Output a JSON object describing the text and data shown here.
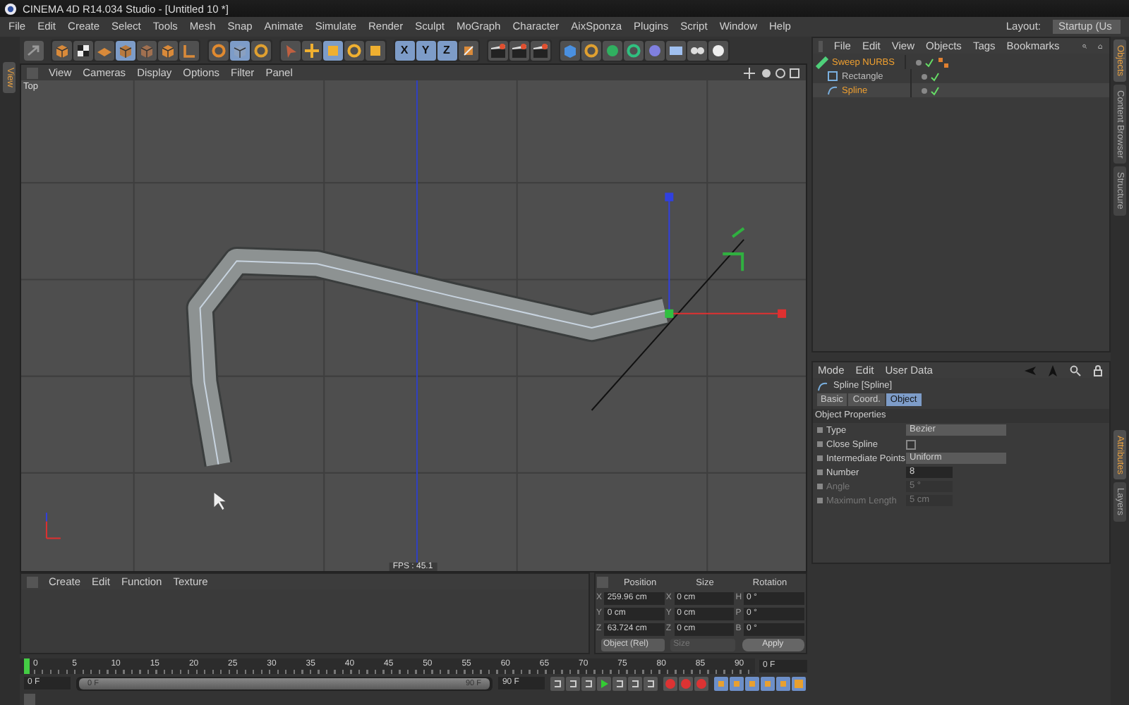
{
  "window": {
    "title": "CINEMA 4D R14.034 Studio - [Untitled 10 *]"
  },
  "menu": [
    "File",
    "Edit",
    "Create",
    "Select",
    "Tools",
    "Mesh",
    "Snap",
    "Animate",
    "Simulate",
    "Render",
    "Sculpt",
    "MoGraph",
    "Character",
    "AixSponza",
    "Plugins",
    "Script",
    "Window",
    "Help"
  ],
  "layout": {
    "label": "Layout:",
    "value": "Startup (Us"
  },
  "axis_buttons": [
    {
      "label": "X",
      "selected": true
    },
    {
      "label": "Y",
      "selected": true
    },
    {
      "label": "Z",
      "selected": true
    }
  ],
  "left_tabs": [
    {
      "label": "View",
      "selected": true
    }
  ],
  "viewport": {
    "menu": [
      "View",
      "Cameras",
      "Display",
      "Options",
      "Filter",
      "Panel"
    ],
    "view_name": "Top",
    "fps": "FPS : 45.1"
  },
  "object_manager": {
    "menu": [
      "File",
      "Edit",
      "View",
      "Objects",
      "Tags",
      "Bookmarks"
    ],
    "objects": [
      {
        "name": "Sweep NURBS",
        "selected": true,
        "children": [
          {
            "name": "Rectangle",
            "selected": false
          },
          {
            "name": "Spline",
            "selected": true
          }
        ]
      }
    ]
  },
  "right_tabs_top": [
    {
      "label": "Objects",
      "selected": true
    },
    {
      "label": "Content Browser",
      "selected": false
    },
    {
      "label": "Structure",
      "selected": false
    }
  ],
  "right_tabs_bottom": [
    {
      "label": "Attributes",
      "selected": true
    },
    {
      "label": "Layers",
      "selected": false
    }
  ],
  "attributes": {
    "menu": [
      "Mode",
      "Edit",
      "User Data"
    ],
    "object": "Spline [Spline]",
    "tabs": [
      {
        "label": "Basic",
        "selected": false
      },
      {
        "label": "Coord.",
        "selected": false
      },
      {
        "label": "Object",
        "selected": true
      }
    ],
    "section": "Object Properties",
    "params": [
      {
        "label": "Type",
        "kind": "dropdown",
        "value": "Bezier",
        "disabled": false
      },
      {
        "label": "Close Spline",
        "kind": "checkbox",
        "checked": false,
        "disabled": false
      },
      {
        "label": "Intermediate Points",
        "kind": "dropdown",
        "value": "Uniform",
        "disabled": false
      },
      {
        "label": "Number",
        "kind": "number",
        "value": "8",
        "disabled": false
      },
      {
        "label": "Angle",
        "kind": "number",
        "value": "5 °",
        "disabled": true
      },
      {
        "label": "Maximum Length",
        "kind": "number",
        "value": "5 cm",
        "disabled": true
      }
    ]
  },
  "material_manager": {
    "menu": [
      "Create",
      "Edit",
      "Function",
      "Texture"
    ]
  },
  "coordinates": {
    "headers": [
      "Position",
      "Size",
      "Rotation"
    ],
    "rows": [
      [
        {
          "axis": "X",
          "value": "259.96 cm"
        },
        {
          "axis": "X",
          "value": "0 cm"
        },
        {
          "axis": "H",
          "value": "0 °"
        }
      ],
      [
        {
          "axis": "Y",
          "value": "0 cm"
        },
        {
          "axis": "Y",
          "value": "0 cm"
        },
        {
          "axis": "P",
          "value": "0 °"
        }
      ],
      [
        {
          "axis": "Z",
          "value": "63.724 cm"
        },
        {
          "axis": "Z",
          "value": "0 cm"
        },
        {
          "axis": "B",
          "value": "0 °"
        }
      ]
    ],
    "mode": "Object (Rel)",
    "size_mode": "Size",
    "apply": "Apply"
  },
  "timeline": {
    "ticks": [
      "0",
      "5",
      "10",
      "15",
      "20",
      "25",
      "30",
      "35",
      "40",
      "45",
      "50",
      "55",
      "60",
      "65",
      "70",
      "75",
      "80",
      "85",
      "90"
    ],
    "frame": "0 F",
    "start": "0 F",
    "range": {
      "start": "0 F",
      "end": "90 F",
      "level": 1
    },
    "end": "90 F"
  }
}
